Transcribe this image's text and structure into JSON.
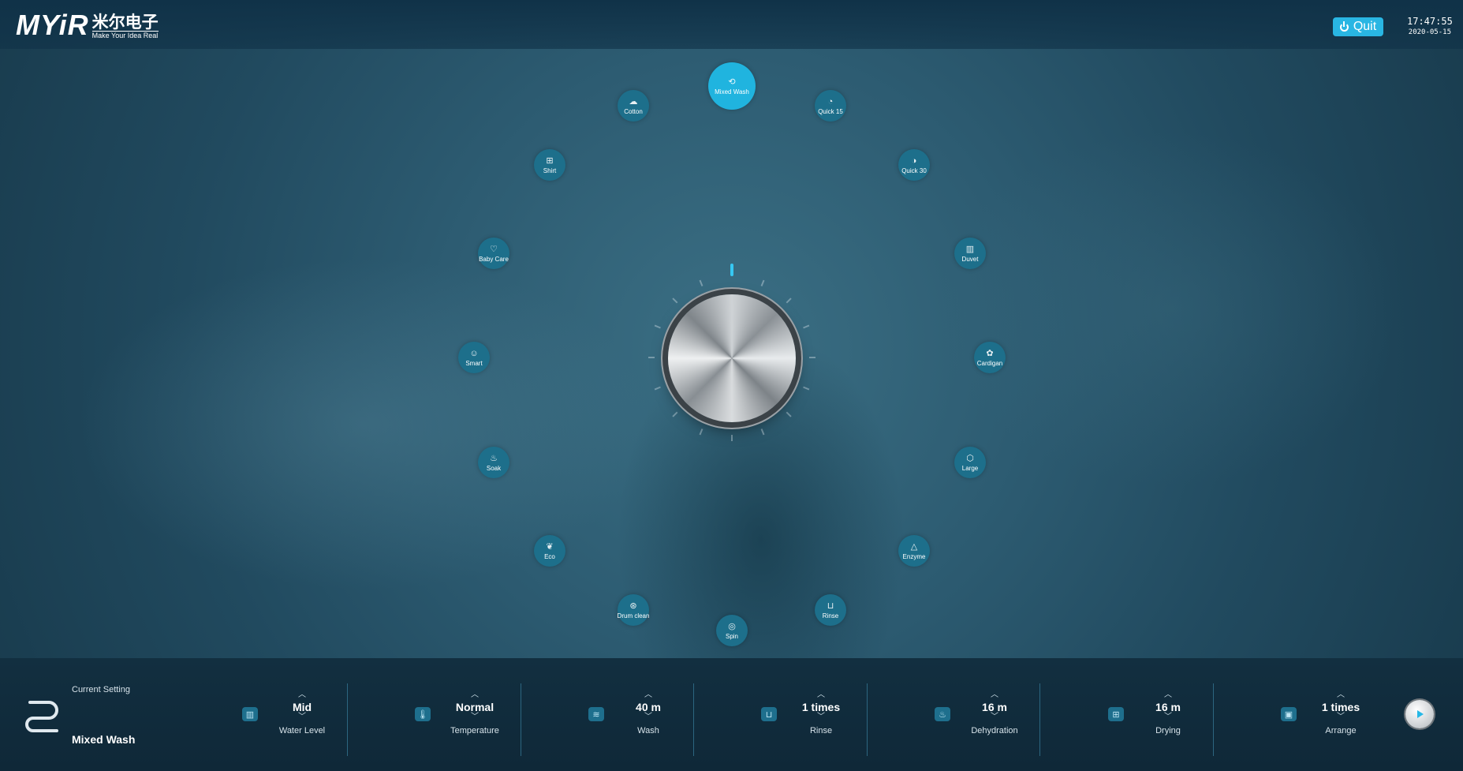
{
  "header": {
    "logo_text": "MYiR",
    "logo_cn": "米尔电子",
    "logo_tagline": "Make Your Idea Real",
    "quit_label": "Quit",
    "time": "17:47:55",
    "date": "2020-05-15"
  },
  "colors": {
    "accent": "#20b4df",
    "program_button": "#1d6f8b",
    "bottom_bar": "#0f2838"
  },
  "programs": [
    {
      "label": "Mixed Wash",
      "icon": "mixed-wash-icon",
      "active": true
    },
    {
      "label": "Quick 15",
      "icon": "quick-15-icon"
    },
    {
      "label": "Quick 30",
      "icon": "quick-30-icon"
    },
    {
      "label": "Duvet",
      "icon": "duvet-icon"
    },
    {
      "label": "Cardigan",
      "icon": "cardigan-icon"
    },
    {
      "label": "Large",
      "icon": "large-icon"
    },
    {
      "label": "Enzyme",
      "icon": "enzyme-icon"
    },
    {
      "label": "Rinse",
      "icon": "rinse-icon"
    },
    {
      "label": "Spin",
      "icon": "spin-icon"
    },
    {
      "label": "Drum clean",
      "icon": "drum-clean-icon"
    },
    {
      "label": "Eco",
      "icon": "eco-icon"
    },
    {
      "label": "Soak",
      "icon": "soak-icon"
    },
    {
      "label": "Smart",
      "icon": "smart-icon"
    },
    {
      "label": "Baby Care",
      "icon": "baby-care-icon"
    },
    {
      "label": "Shirt",
      "icon": "shirt-icon"
    },
    {
      "label": "Cotton",
      "icon": "cotton-icon"
    }
  ],
  "current": {
    "label": "Current Setting",
    "name": "Mixed Wash"
  },
  "settings": [
    {
      "value": "Mid",
      "label": "Water Level",
      "icon": "water-level-icon"
    },
    {
      "value": "Normal",
      "label": "Temperature",
      "icon": "thermometer-icon"
    },
    {
      "value": "40 m",
      "label": "Wash",
      "icon": "wash-tub-icon"
    },
    {
      "value": "1 times",
      "label": "Rinse",
      "icon": "rinse-setting-icon"
    },
    {
      "value": "16 m",
      "label": "Dehydration",
      "icon": "dehydration-icon"
    },
    {
      "value": "16 m",
      "label": "Drying",
      "icon": "drying-shirt-icon"
    },
    {
      "value": "1 times",
      "label": "Arrange",
      "icon": "arrange-icon"
    }
  ]
}
